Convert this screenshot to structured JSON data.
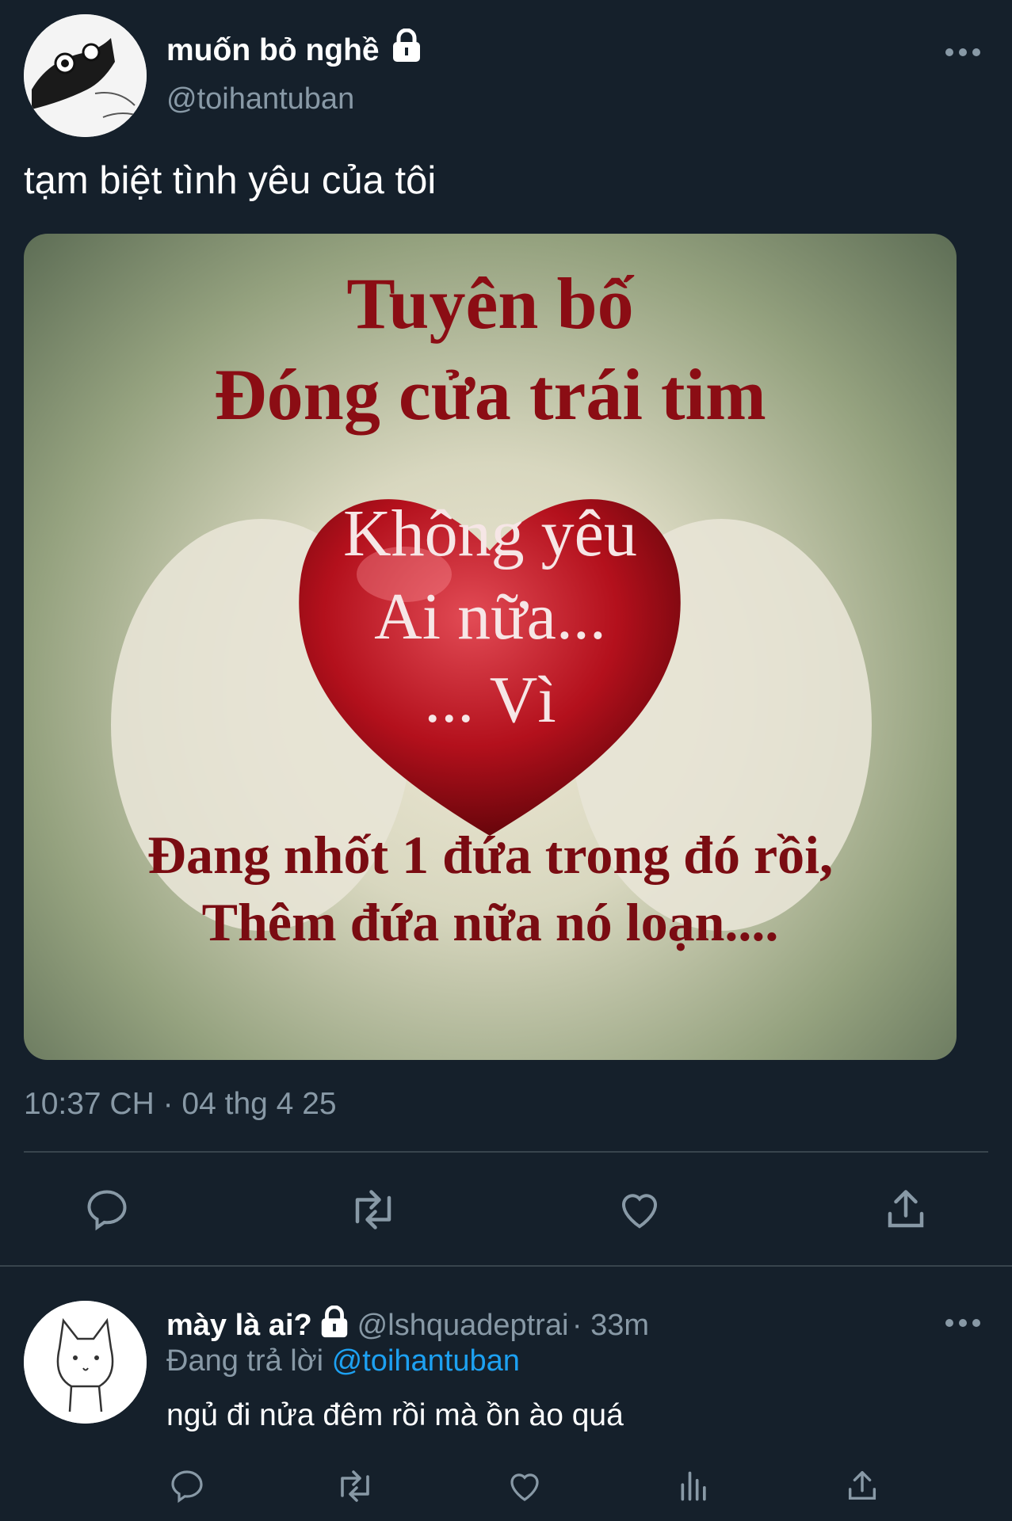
{
  "tweet": {
    "display_name": "muốn bỏ nghề",
    "handle": "@toihantuban",
    "text": "tạm biệt tình yêu của tôi",
    "timestamp": "10:37 CH · 04 thg 4 25",
    "media_lines": [
      "Tuyên bố",
      "Đóng cửa trái tim",
      "Không yêu",
      "Ai nữa...",
      "... Vì",
      "Đang nhốt 1 đứa trong đó rồi,",
      "Thêm đứa nữa nó loạn...."
    ]
  },
  "reply": {
    "display_name": "mày là ai?",
    "handle": "@lshquadeptrai",
    "time": "· 33m",
    "replying_label": "Đang trả lời",
    "replying_to": "@toihantuban",
    "text": "ngủ đi nửa đêm rồi mà ồn ào quá"
  },
  "icons": {
    "lock": "lock-icon",
    "more": "more-icon",
    "reply": "reply-icon",
    "retweet": "retweet-icon",
    "like": "like-icon",
    "share": "share-icon",
    "analytics": "analytics-icon"
  },
  "colors": {
    "background": "#15202b",
    "muted": "#8899a6",
    "link": "#1da1f2",
    "divider": "#38444d"
  }
}
